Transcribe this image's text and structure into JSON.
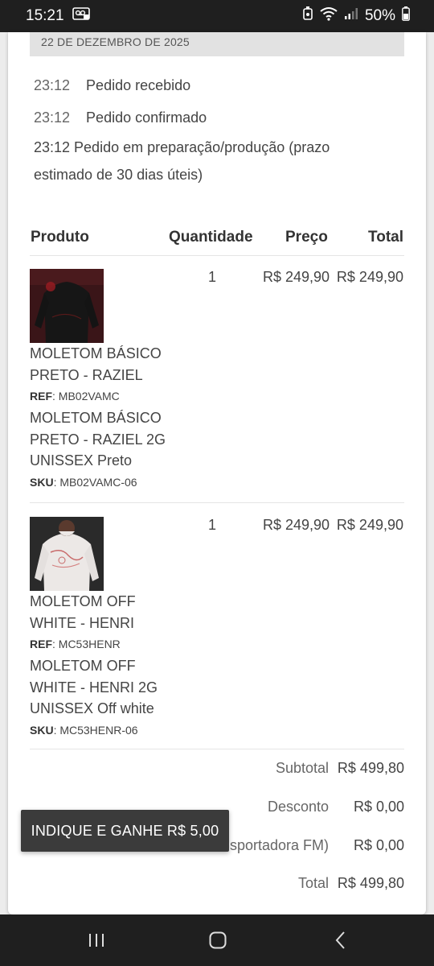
{
  "status_bar": {
    "time": "15:21",
    "battery": "50%",
    "icons": [
      "voicemail-icon",
      "alarm-icon",
      "wifi-icon",
      "signal-icon",
      "battery-icon"
    ]
  },
  "order": {
    "date": "22 DE DEZEMBRO DE 2025",
    "timeline": [
      {
        "time": "23:12",
        "text": "Pedido recebido"
      },
      {
        "time": "23:12",
        "text": "Pedido confirmado"
      }
    ],
    "timeline_long": "23:12 Pedido em preparação/produção (prazo estimado de 30 dias úteis)"
  },
  "table": {
    "headers": {
      "product": "Produto",
      "quantity": "Quantidade",
      "price": "Preço",
      "total": "Total"
    },
    "items": [
      {
        "name": "MOLETOM BÁSICO PRETO - RAZIEL",
        "ref_label": "REF",
        "ref": ": MB02VAMC",
        "variant": "MOLETOM BÁSICO PRETO - RAZIEL 2G UNISSEX Preto",
        "sku_label": "SKU",
        "sku": ": MB02VAMC-06",
        "quantity": "1",
        "price": "R$ 249,90",
        "total": "R$ 249,90"
      },
      {
        "name": "MOLETOM OFF WHITE - HENRI",
        "ref_label": "REF",
        "ref": ": MC53HENR",
        "variant": "MOLETOM OFF WHITE - HENRI 2G UNISSEX Off white",
        "sku_label": "SKU",
        "sku": ": MC53HENR-06",
        "quantity": "1",
        "price": "R$ 249,90",
        "total": "R$ 249,90"
      }
    ]
  },
  "summary": {
    "subtotal_label": "Subtotal",
    "subtotal": "R$ 499,80",
    "discount_label": "Desconto",
    "discount": "R$ 0,00",
    "shipping_label": "sportadora FM)",
    "shipping": "R$ 0,00",
    "total_label": "Total",
    "total": "R$ 499,80"
  },
  "toast": {
    "text": "INDIQUE E GANHE R$ 5,00"
  },
  "nav": {
    "icons": [
      "recent-apps-icon",
      "home-icon",
      "back-icon"
    ]
  }
}
